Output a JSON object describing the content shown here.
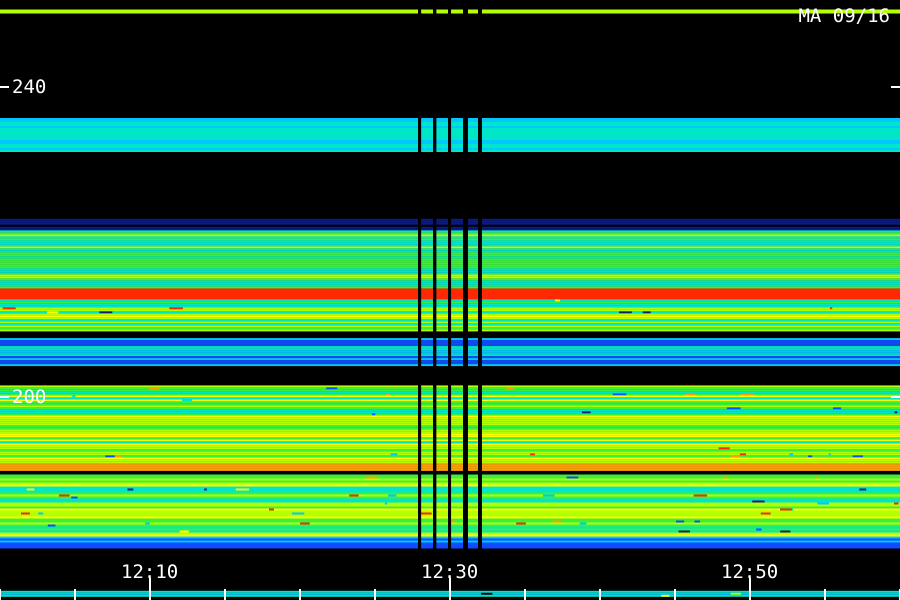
{
  "header": {
    "station_date": "MA 09/16"
  },
  "chart_data": {
    "type": "heatmap",
    "title": "",
    "xlabel": "",
    "ylabel": "",
    "x_ticks": [
      "12:10",
      "12:30",
      "12:50"
    ],
    "y_ticks": [
      240,
      200
    ],
    "x_range": [
      "12:00",
      "13:00"
    ],
    "y_range": [
      169,
      250
    ],
    "colormap": [
      "#000000",
      "#0a1a8c",
      "#0f4cff",
      "#00c8ff",
      "#00e6c8",
      "#3cf03c",
      "#b4ff00",
      "#ffff00",
      "#ffa000",
      "#ff2800"
    ],
    "vertical_gaps": [
      "12:28",
      "12:29",
      "12:30",
      "12:31",
      "12:32"
    ],
    "bands": [
      {
        "from": 250,
        "to": 249.6,
        "level": 6
      },
      {
        "from": 236,
        "to": 231.8,
        "level": 3.5,
        "var": 0.8
      },
      {
        "from": 223,
        "to": 219.5,
        "level": 0.6,
        "var": 0.3
      },
      {
        "from": 221,
        "to": 220.2,
        "level": 1.8
      },
      {
        "from": 221.5,
        "to": 214,
        "level": 4.8,
        "var": 1.4,
        "speck": 0.05
      },
      {
        "from": 214,
        "to": 212.6,
        "level": 8.7
      },
      {
        "from": 212.6,
        "to": 208.5,
        "level": 5.2,
        "var": 1.5,
        "speck": 0.25
      },
      {
        "from": 207.6,
        "to": 204,
        "level": 2.5,
        "var": 1.2
      },
      {
        "from": 201.5,
        "to": 191.5,
        "level": 5.3,
        "var": 1.6,
        "speck": 0.3
      },
      {
        "from": 191.5,
        "to": 190.5,
        "level": 8.0
      },
      {
        "from": 190,
        "to": 182,
        "level": 5.5,
        "var": 1.7,
        "speck": 0.55
      },
      {
        "from": 182,
        "to": 180.5,
        "level": 2.5,
        "var": 1
      },
      {
        "from": 175,
        "to": 174.4,
        "level": 3,
        "var": 1,
        "speck": 0.6
      },
      {
        "from": 173,
        "to": 170.8,
        "level": 3.2,
        "var": 1.2,
        "speck": 0.7
      }
    ]
  }
}
